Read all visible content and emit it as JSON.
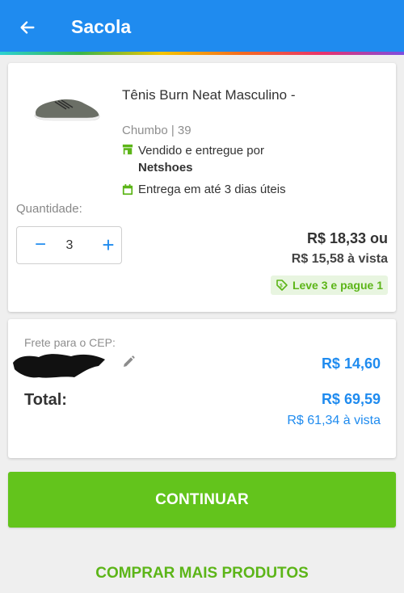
{
  "header": {
    "title": "Sacola",
    "back_icon": "arrow-left-icon"
  },
  "product": {
    "name": "Tênis Burn Neat Masculino -",
    "variant": "Chumbo | 39",
    "seller_label": "Vendido e entregue por",
    "seller_name": "Netshoes",
    "delivery": "Entrega em até 3 dias úteis",
    "quantity_label": "Quantidade:",
    "quantity": "3",
    "minus": "−",
    "plus": "+",
    "price": "R$ 18,33 ou",
    "price_cash": "R$ 15,58 à vista",
    "promo": "Leve 3 e pague 1"
  },
  "shipping": {
    "cep_label": "Frete para o CEP:",
    "price": "R$ 14,60",
    "total_label": "Total:",
    "total": "R$ 69,59",
    "total_cash": "R$ 61,34 à vista"
  },
  "actions": {
    "continue": "CONTINUAR",
    "more": "COMPRAR MAIS PRODUTOS"
  },
  "colors": {
    "primary": "#1f8bef",
    "green": "#63c41c",
    "promo_green": "#5cb518"
  }
}
